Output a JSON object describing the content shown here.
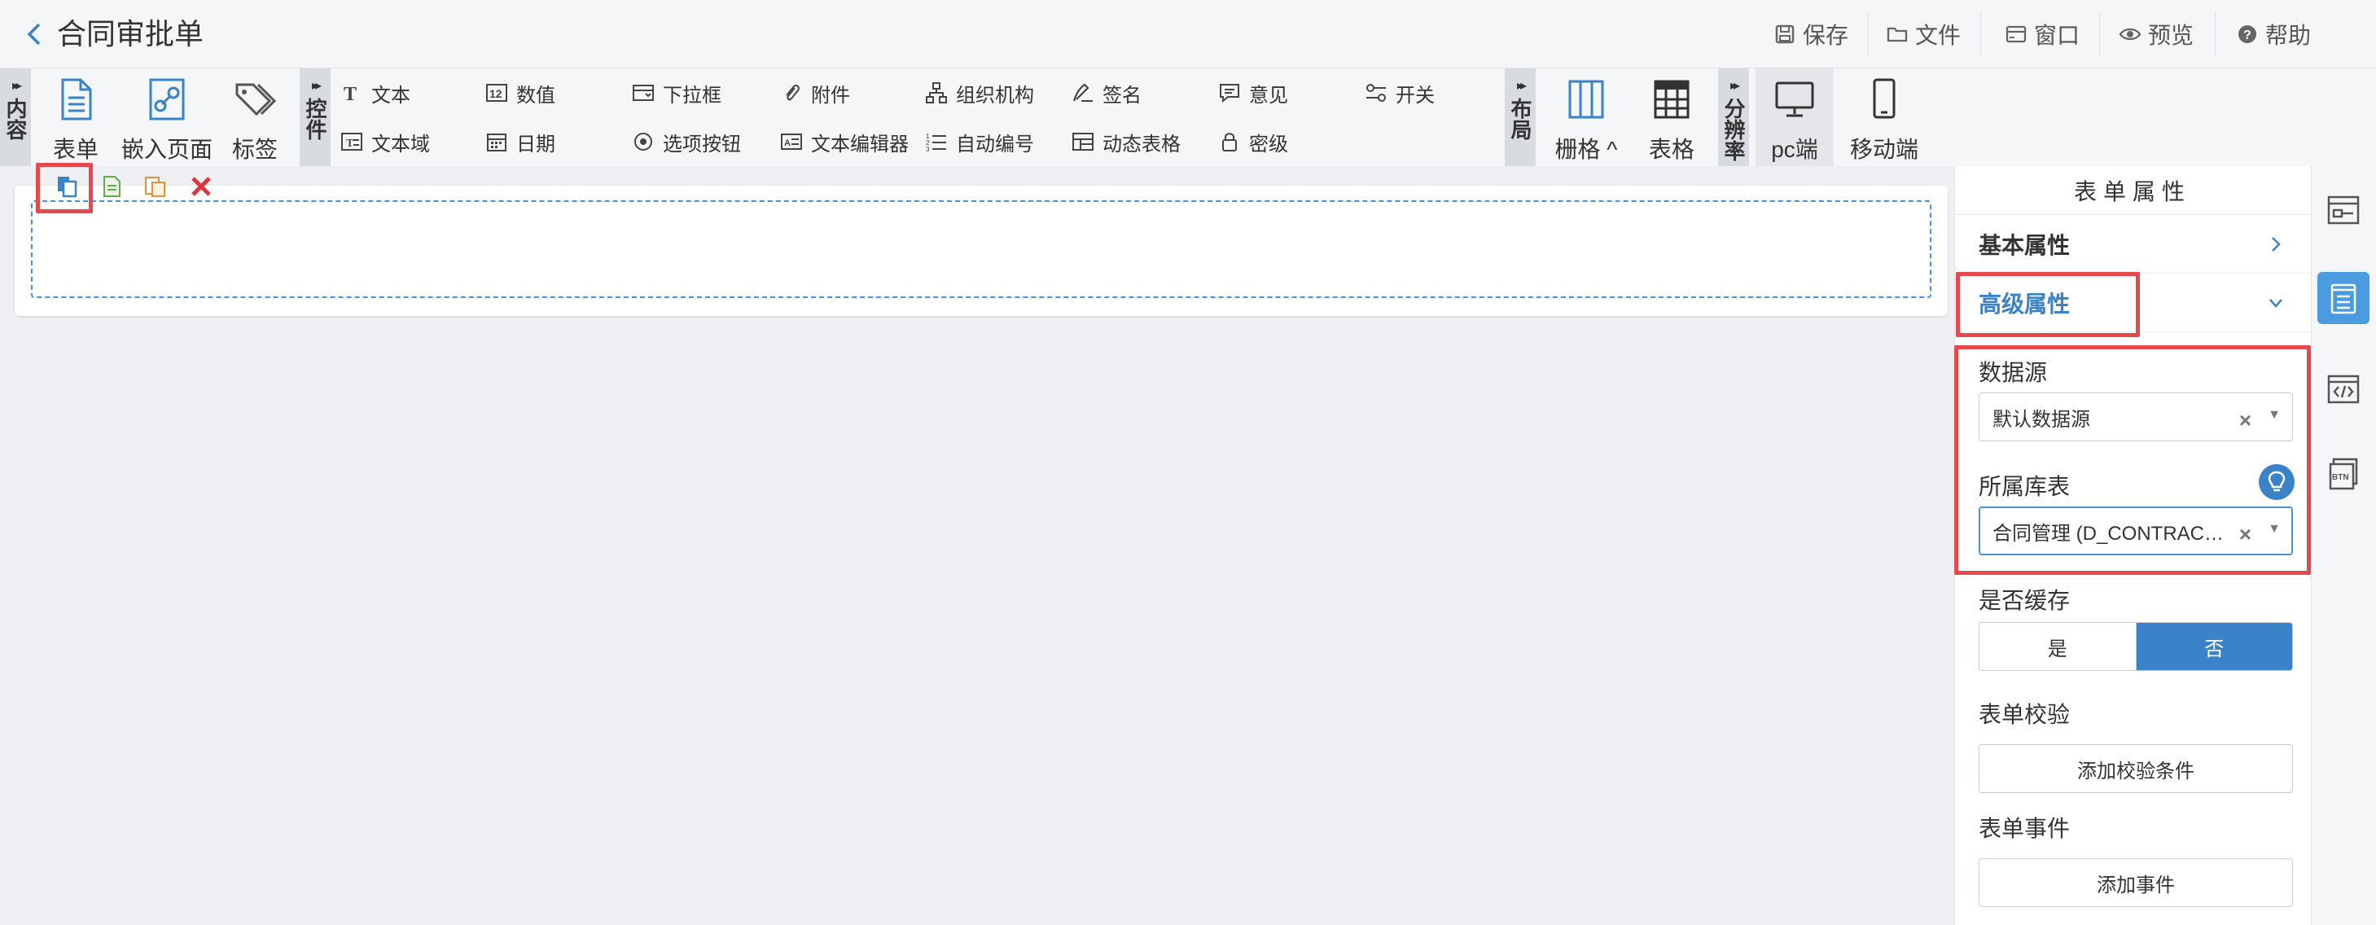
{
  "header": {
    "title": "合同审批单",
    "buttons": {
      "save": "保存",
      "file": "文件",
      "window": "窗口",
      "preview": "预览",
      "help": "帮助"
    }
  },
  "toolbar": {
    "content_group": "内容",
    "content_items": {
      "form": "表单",
      "embed": "嵌入页面",
      "tag": "标签"
    },
    "control_group": "控件",
    "controls": {
      "text": "文本",
      "number": "数值",
      "dropdown": "下拉框",
      "attachment": "附件",
      "org": "组织机构",
      "signature": "签名",
      "opinion": "意见",
      "switch": "开关",
      "textarea": "文本域",
      "date": "日期",
      "option_button": "选项按钮",
      "text_editor": "文本编辑器",
      "auto_number": "自动编号",
      "dynamic_table": "动态表格",
      "secret_level": "密级"
    },
    "layout_group": "布局",
    "layout_items": {
      "grid": "栅格 ^",
      "table": "表格"
    },
    "resolution_group": "分辨率",
    "resolution_items": {
      "pc": "pc端",
      "mobile": "移动端"
    }
  },
  "panel": {
    "title": "表单属性",
    "basic_section": "基本属性",
    "advanced_section": "高级属性",
    "datasource_label": "数据源",
    "datasource_value": "默认数据源",
    "table_label": "所属库表",
    "table_value": "合同管理 (D_CONTRACT_MANAGE)",
    "cache_label": "是否缓存",
    "cache_yes": "是",
    "cache_no": "否",
    "cache_selected": "否",
    "validation_label": "表单校验",
    "validation_button": "添加校验条件",
    "event_label": "表单事件",
    "event_button": "添加事件"
  },
  "colors": {
    "accent": "#3a83c9",
    "highlight": "#e5484d",
    "dashed": "#4a90d9"
  }
}
